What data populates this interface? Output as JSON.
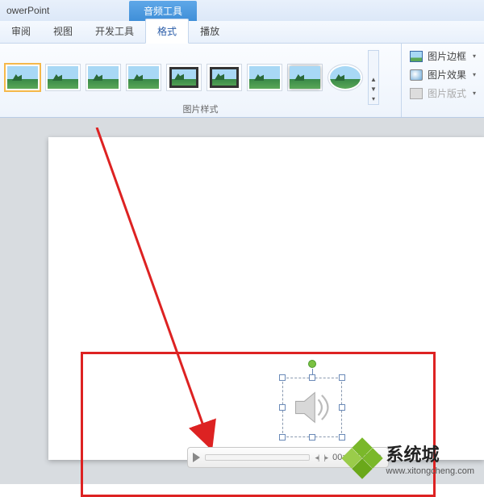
{
  "title_bar": {
    "app_name": "owerPoint",
    "context_tab": "音频工具"
  },
  "tabs": {
    "review": "审阅",
    "view": "视图",
    "developer": "开发工具",
    "format": "格式",
    "playback": "播放"
  },
  "ribbon": {
    "group_label": "图片样式",
    "border": "图片边框",
    "effects": "图片效果",
    "layout": "图片版式",
    "dd": "▾"
  },
  "media": {
    "time": "00:00.00",
    "skip_back": "◂|",
    "skip_fwd": "|▸"
  },
  "watermark": {
    "cn": "系统城",
    "url": "www.xitongcheng.com"
  }
}
